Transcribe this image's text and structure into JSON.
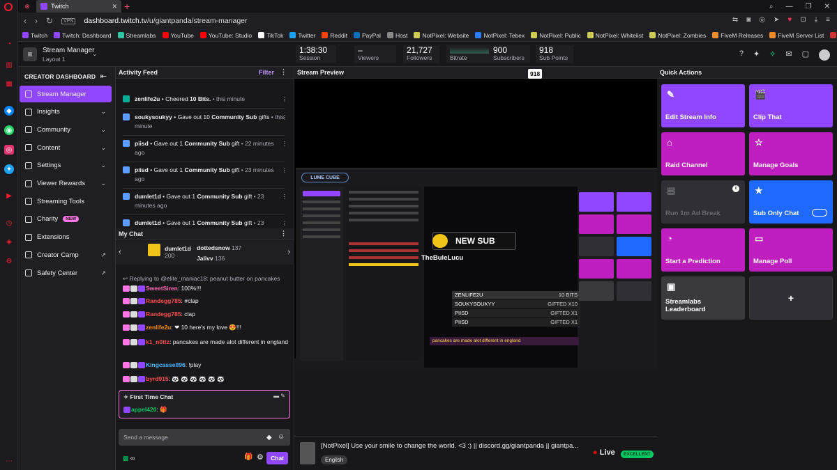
{
  "browser": {
    "tab_title": "Twitch",
    "new_tab": "+",
    "vpn": "VPN",
    "url_domain": "dashboard.twitch.tv",
    "url_path": "/u/giantpanda/stream-manager",
    "bookmarks": [
      {
        "label": "Twitch",
        "color": "#9147ff"
      },
      {
        "label": "Twitch: Dashboard",
        "color": "#9147ff"
      },
      {
        "label": "Streamlabs",
        "color": "#31c3a2"
      },
      {
        "label": "YouTube",
        "color": "#ff0000"
      },
      {
        "label": "YouTube: Studio",
        "color": "#ff0000"
      },
      {
        "label": "TikTok",
        "color": "#ffffff"
      },
      {
        "label": "Twitter",
        "color": "#1da1f2"
      },
      {
        "label": "Reddit",
        "color": "#ff4500"
      },
      {
        "label": "PayPal",
        "color": "#0070ba"
      },
      {
        "label": "Host",
        "color": "#888888"
      },
      {
        "label": "NotPixel: Website",
        "color": "#cccc55"
      },
      {
        "label": "NotPixel: Tebex",
        "color": "#2a7fff"
      },
      {
        "label": "NotPixel: Public",
        "color": "#cccc55"
      },
      {
        "label": "NotPixel: Whitelist",
        "color": "#cccc55"
      },
      {
        "label": "NotPixel: Zombies",
        "color": "#cccc55"
      },
      {
        "label": "FiveM Releases",
        "color": "#f08b29"
      },
      {
        "label": "FiveM Server List",
        "color": "#f08b29"
      },
      {
        "label": "Ontario",
        "color": "#cc3333"
      }
    ]
  },
  "header": {
    "title": "Stream Manager",
    "layout": "Layout 1",
    "stats": [
      {
        "value": "1:38:30",
        "label": "Session"
      },
      {
        "value": "–",
        "label": "Viewers"
      },
      {
        "value": "21,727",
        "label": "Followers"
      },
      {
        "value": "",
        "label": "Bitrate"
      },
      {
        "value": "900",
        "label": "Subscribers"
      },
      {
        "value": "918",
        "label": "Sub Points"
      }
    ]
  },
  "nav": {
    "heading": "CREATOR DASHBOARD",
    "items": [
      {
        "label": "Stream Manager",
        "active": true,
        "chev": ""
      },
      {
        "label": "Insights",
        "chev": "⌄"
      },
      {
        "label": "Community",
        "chev": "⌄"
      },
      {
        "label": "Content",
        "chev": "⌄"
      },
      {
        "label": "Settings",
        "chev": "⌄"
      },
      {
        "label": "Viewer Rewards",
        "chev": "⌄"
      },
      {
        "label": "Streaming Tools",
        "chev": ""
      },
      {
        "label": "Charity",
        "chev": "",
        "badge": "NEW"
      },
      {
        "label": "Extensions",
        "chev": ""
      },
      {
        "label": "Creator Camp",
        "chev": "↗"
      },
      {
        "label": "Safety Center",
        "chev": "↗"
      }
    ]
  },
  "activity": {
    "title": "Activity Feed",
    "filter": "Filter",
    "items": [
      {
        "user": "zenlife2u",
        "text": " • Cheered ",
        "bold2": "10 Bits.",
        "time": " • this minute",
        "color": "#00ad96"
      },
      {
        "user": "soukysoukyy",
        "text": " • Gave out 10 ",
        "bold2": "Community Sub",
        "tail": " gifts",
        "time": " • this minute",
        "color": "#5c9cff"
      },
      {
        "user": "piisd",
        "text": " • Gave out 1 ",
        "bold2": "Community Sub",
        "tail": " gift",
        "time": " • 22 minutes ago",
        "color": "#5c9cff"
      },
      {
        "user": "piisd",
        "text": " • Gave out 1 ",
        "bold2": "Community Sub",
        "tail": " gift",
        "time": " • 23 minutes ago",
        "color": "#5c9cff"
      },
      {
        "user": "dumlet1d",
        "text": " • Gave out 1 ",
        "bold2": "Community Sub",
        "tail": " gift",
        "time": " • 23 minutes ago",
        "color": "#5c9cff"
      },
      {
        "user": "dumlet1d",
        "text": " • Gave out 1 ",
        "bold2": "Community Sub",
        "tail": " gift",
        "time": " • 23",
        "color": "#5c9cff"
      }
    ]
  },
  "chat": {
    "title": "My Chat",
    "gifters": [
      {
        "name": "dumlet1d",
        "count": "200"
      },
      {
        "name": "dottedsnow",
        "count": "137"
      },
      {
        "name": "Jalivv",
        "count": "136"
      }
    ],
    "reply": "Replying to @elite_maniac18: peanut butter on pancakes",
    "lines": [
      {
        "user": "SweetSiren",
        "color": "#ff69b4",
        "msg": ": 100%!!!"
      },
      {
        "user": "Randegg785",
        "color": "#ff4f4f",
        "msg": ": #clap"
      },
      {
        "user": "Randegg785",
        "color": "#ff4f4f",
        "msg": ": clap"
      },
      {
        "user": "zenlife2u",
        "color": "#ff8c00",
        "msg": ": ❤ 10 here's my love 😍!!!"
      },
      {
        "user": "k1_n0ttz",
        "color": "#ff4f4f",
        "msg": ": pancakes are made alot different in england"
      },
      {
        "user": "Kingcassell96",
        "color": "#4fb8ff",
        "msg": ": !play"
      },
      {
        "user": "byrd915",
        "color": "#ff4f4f",
        "msg": ": 🐼 🐼 🐼 🐼 🐼 🐼"
      }
    ],
    "first_time": {
      "title": "First Time Chat",
      "user": "appel420",
      "msg": ": 🎁"
    },
    "placeholder": "Send a message",
    "chat_button": "Chat",
    "points": "∞"
  },
  "preview": {
    "title": "Stream Preview",
    "badge": "918",
    "overlay": {
      "brand": "LUME CUBE",
      "new_sub": "NEW SUB",
      "sub_name": "TheBuleLucu",
      "list": [
        {
          "name": "ZENLIFE2U",
          "val": "10 BITS"
        },
        {
          "name": "SOUKYSOUKYY",
          "val": "GIFTED X10"
        },
        {
          "name": "PIISD",
          "val": "GIFTED X1"
        },
        {
          "name": "PIISD",
          "val": "GIFTED X1"
        }
      ],
      "ticker": "pancakes are made alot different in england"
    },
    "stream_title": "[NotPixel] Use your smile to change the world. <3 :) || discord.gg/giantpanda ||  giantpa...",
    "tag": "English",
    "live": "Live",
    "quality": "EXCELLENT"
  },
  "quick_actions": {
    "title": "Quick Actions",
    "items": [
      {
        "label": "Edit Stream Info",
        "color": "#9147ff",
        "icon": "✎"
      },
      {
        "label": "Clip That",
        "color": "#9147ff",
        "icon": "🎬"
      },
      {
        "label": "Raid Channel",
        "color": "#bf1fbe",
        "icon": "⌂"
      },
      {
        "label": "Manage Goals",
        "color": "#bf1fbe",
        "icon": "☆"
      },
      {
        "label": "Run 1m Ad Break",
        "color": "#2f2f35",
        "icon": "▤",
        "info": "i"
      },
      {
        "label": "Sub Only Chat",
        "color": "#1f69ff",
        "icon": "★"
      },
      {
        "label": "Start a Prediction",
        "color": "#bf1fbe",
        "icon": "◔"
      },
      {
        "label": "Manage Poll",
        "color": "#bf1fbe",
        "icon": "▭"
      },
      {
        "label": "Streamlabs\nLeaderboard",
        "color": "#3a3a3d",
        "icon": "▣"
      },
      {
        "label": "+",
        "color": "#2f2f35",
        "icon": ""
      }
    ]
  }
}
